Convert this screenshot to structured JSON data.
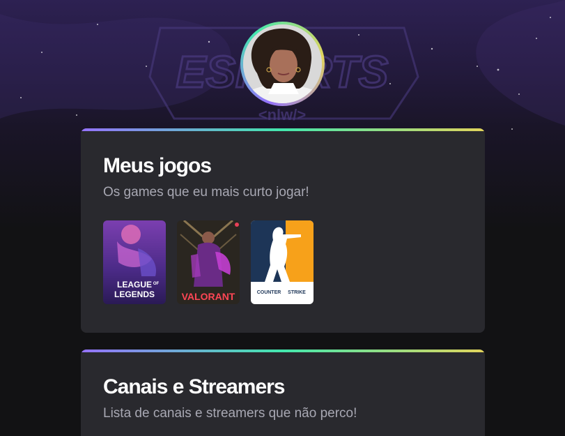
{
  "profile": {
    "avatar_icon": "profile-photo"
  },
  "background": {
    "logo_text": "ESPORTS",
    "logo_sub": "<nlw/>"
  },
  "cards": [
    {
      "title": "Meus jogos",
      "subtitle": "Os games que eu mais curto jogar!",
      "games": [
        {
          "name": "League of Legends",
          "cover_line1": "LEAGUE",
          "cover_of": "OF",
          "cover_line2": "LEGENDS"
        },
        {
          "name": "Valorant",
          "cover_text": "VALORANT"
        },
        {
          "name": "Counter-Strike",
          "cover_text_a": "COUNTER",
          "cover_text_b": "STRIKE"
        }
      ]
    },
    {
      "title": "Canais e Streamers",
      "subtitle": "Lista de canais e streamers que não perco!"
    }
  ],
  "colors": {
    "page_bg": "#121214",
    "card_bg": "#29292e",
    "gradient": [
      "#9572fc",
      "#43e7ad",
      "#e2d45c"
    ],
    "title": "#ffffff",
    "subtitle": "#a8a8b3"
  }
}
